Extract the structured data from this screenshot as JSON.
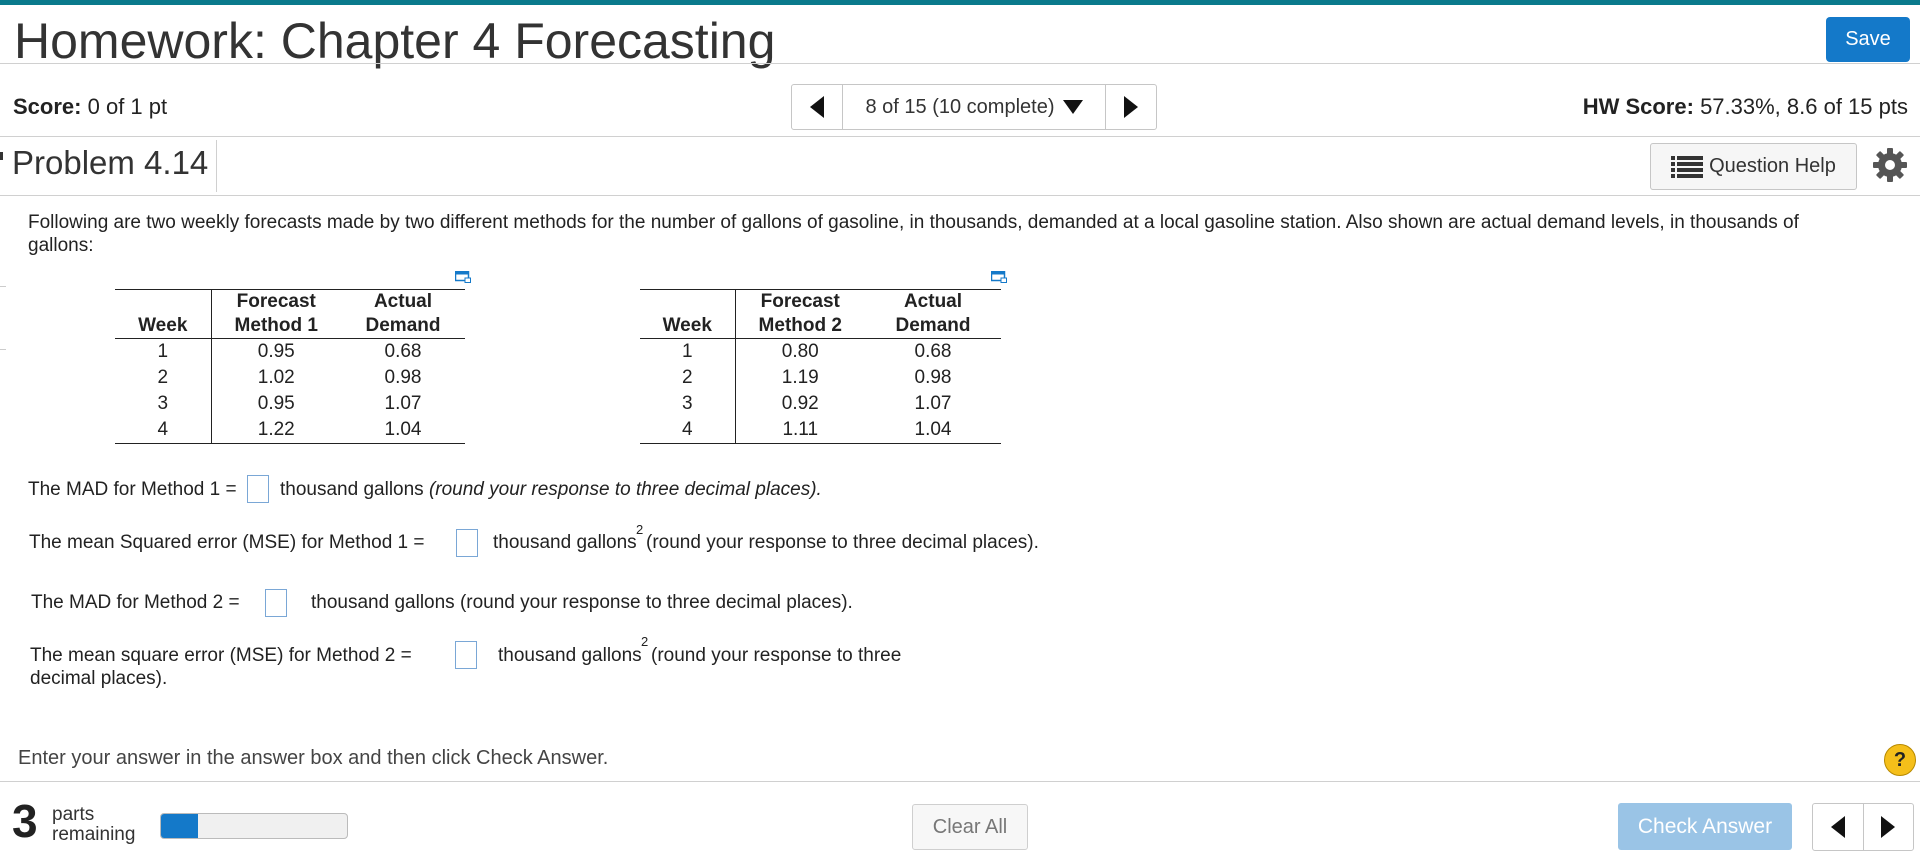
{
  "header": {
    "title": "Homework: Chapter 4 Forecasting",
    "save_label": "Save",
    "score_label": "Score:",
    "score_value": "0 of 1 pt",
    "question_nav": "8 of 15 (10 complete)",
    "hw_score_label": "HW Score:",
    "hw_score_value": "57.33%, 8.6 of 15 pts"
  },
  "problem": {
    "title": "Problem 4.14",
    "question_help_label": "Question Help"
  },
  "intro": "Following are two weekly forecasts made by two different methods for the number of gallons of gasoline, in thousands, demanded at a local gasoline station. Also shown are actual demand levels, in thousands of gallons:",
  "table1": {
    "headers": {
      "week": "Week",
      "forecast_top": "Forecast",
      "forecast_bottom": "Method 1",
      "actual_top": "Actual",
      "actual_bottom": "Demand"
    },
    "rows": [
      {
        "week": "1",
        "forecast": "0.95",
        "actual": "0.68"
      },
      {
        "week": "2",
        "forecast": "1.02",
        "actual": "0.98"
      },
      {
        "week": "3",
        "forecast": "0.95",
        "actual": "1.07"
      },
      {
        "week": "4",
        "forecast": "1.22",
        "actual": "1.04"
      }
    ]
  },
  "table2": {
    "headers": {
      "week": "Week",
      "forecast_top": "Forecast",
      "forecast_bottom": "Method 2",
      "actual_top": "Actual",
      "actual_bottom": "Demand"
    },
    "rows": [
      {
        "week": "1",
        "forecast": "0.80",
        "actual": "0.68"
      },
      {
        "week": "2",
        "forecast": "1.19",
        "actual": "0.98"
      },
      {
        "week": "3",
        "forecast": "0.92",
        "actual": "1.07"
      },
      {
        "week": "4",
        "forecast": "1.11",
        "actual": "1.04"
      }
    ]
  },
  "questions": {
    "q1_prefix": "The MAD for Method 1 =",
    "q1_unit": "thousand gallons",
    "q1_note": "(round your response to three decimal places).",
    "q1_value": "",
    "q2_prefix": "The mean Squared error (MSE) for Method 1 =",
    "q2_unit": "thousand gallons",
    "q2_sup": "2",
    "q2_note": "(round your response to three decimal places).",
    "q2_value": "",
    "q3_prefix": "The MAD for Method 2 =",
    "q3_suffix": "thousand gallons (round your response to three decimal places).",
    "q3_value": "",
    "q4_prefix": "The mean square error (MSE) for Method 2 =",
    "q4_unit": "thousand gallons",
    "q4_sup": "2",
    "q4_note": "(round your response to three",
    "q4_note_line2": "decimal places).",
    "q4_value": ""
  },
  "footer": {
    "instruction": "Enter your answer in the answer box and then click Check Answer.",
    "help_symbol": "?",
    "parts_count": "3",
    "parts_line1": "parts",
    "parts_line2": "remaining",
    "progress_fraction": 0.2,
    "clear_all_label": "Clear All",
    "check_answer_label": "Check Answer"
  },
  "colors": {
    "accent_bar": "#0a7a8c",
    "save_button": "#1479c9",
    "check_answer_disabled": "#9ac4e6",
    "progress_fill": "#1479c9",
    "help_circle": "#f5bf1a"
  },
  "icons": {
    "prev": "triangle-left-icon",
    "next": "triangle-right-icon",
    "dropdown": "triangle-down-icon",
    "question_help": "list-icon",
    "settings": "gear-icon",
    "expand": "expand-table-icon",
    "help": "help-circle-icon"
  }
}
